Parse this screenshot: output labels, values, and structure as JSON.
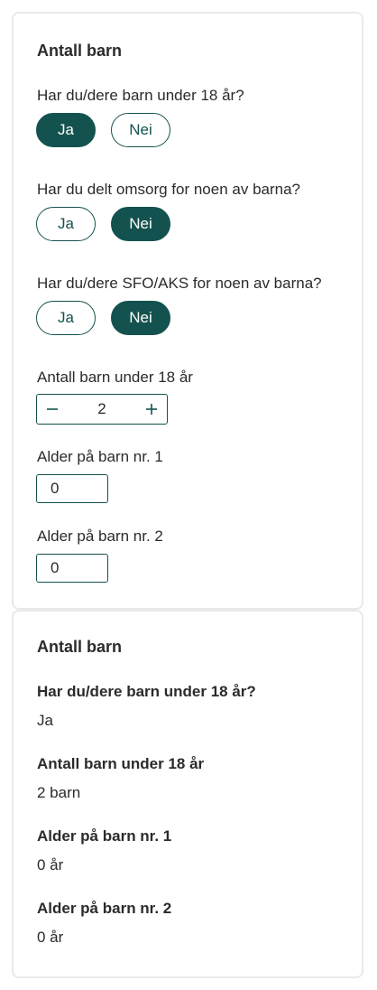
{
  "form": {
    "title": "Antall barn",
    "q_children": "Har du/dere barn under 18 år?",
    "q_shared_care": "Har du delt omsorg for noen av barna?",
    "q_sfo": "Har du/dere SFO/AKS for noen av barna?",
    "yes_label": "Ja",
    "no_label": "Nei",
    "children_selected": "Ja",
    "shared_care_selected": "Nei",
    "sfo_selected": "Nei",
    "count_label": "Antall barn under 18 år",
    "count_value": "2",
    "age1_label": "Alder på barn nr. 1",
    "age1_value": "0",
    "age2_label": "Alder på barn nr. 2",
    "age2_value": "0"
  },
  "summary": {
    "title": "Antall barn",
    "q_children_label": "Har du/dere barn under 18 år?",
    "q_children_value": "Ja",
    "count_label": "Antall barn under 18 år",
    "count_value": "2 barn",
    "age1_label": "Alder på barn nr. 1",
    "age1_value": "0 år",
    "age2_label": "Alder på barn nr. 2",
    "age2_value": "0 år"
  },
  "colors": {
    "accent": "#14524f",
    "border": "#e9e9e9",
    "text": "#2b2b2b"
  },
  "icons": [
    "minus-icon",
    "plus-icon"
  ]
}
